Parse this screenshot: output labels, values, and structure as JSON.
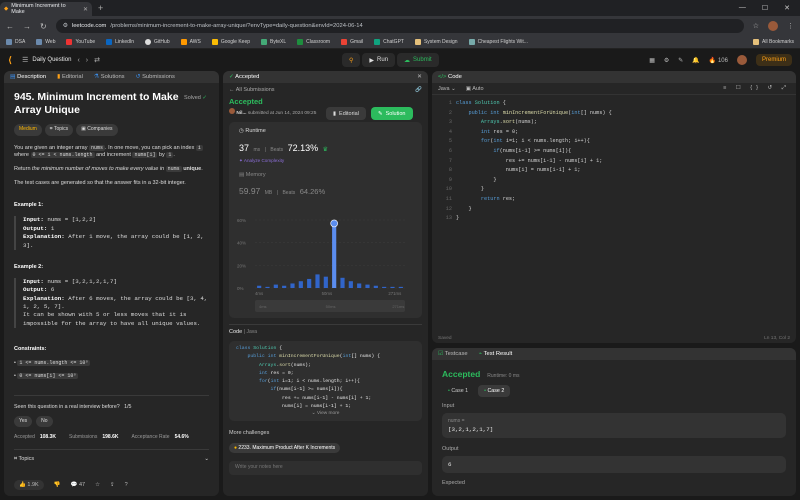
{
  "browser": {
    "tab_title": "Minimum Increment to Make",
    "url_host": "leetcode.com",
    "url_path": "/problems/minimum-increment-to-make-array-unique/?envType=daily-question&envId=2024-06-14",
    "bookmarks": [
      "DSA",
      "Web",
      "YouTube",
      "LinkedIn",
      "GitHub",
      "AWS",
      "Google Keep",
      "ByteXL",
      "Classroom",
      "Gmail",
      "ChatGPT",
      "System Design",
      "Cheapest Flights Wit..."
    ],
    "all_bookmarks": "All Bookmarks"
  },
  "nav": {
    "daily": "Daily Question",
    "run": "Run",
    "submit": "Submit",
    "streak": "106",
    "premium": "Premium"
  },
  "desc": {
    "tabs": [
      "Description",
      "Editorial",
      "Solutions",
      "Submissions"
    ],
    "title": "945. Minimum Increment to Make Array Unique",
    "solved": "Solved",
    "difficulty": "Medium",
    "topics": "Topics",
    "companies": "Companies",
    "p1a": "You are given an integer array",
    "p1b": "nums",
    "p1c": ". In one move, you can pick an index",
    "p1d": "i",
    "p1e": "where",
    "p1f": "0 <= i < nums.length",
    "p1g": "and increment",
    "p1h": "nums[i]",
    "p1i": "by",
    "p1j": "1",
    "p2a": "Return",
    "p2b": "the minimum number of moves to make every value in",
    "p2c": "nums",
    "p2d": "unique",
    "p3": "The test cases are generated so that the answer fits in a 32-bit integer.",
    "ex1": {
      "h": "Example 1:",
      "input": "nums = [1,2,2]",
      "output": "1",
      "expl": "After 1 move, the array could be [1, 2, 3]."
    },
    "ex2": {
      "h": "Example 2:",
      "input": "nums = [3,2,1,2,1,7]",
      "output": "6",
      "expl": "After 6 moves, the array could be [3, 4, 1, 2, 5, 7].",
      "expl2": "It can be shown with 5 or less moves that it is impossible for the array to have all unique values."
    },
    "cons_h": "Constraints:",
    "cons": [
      "1 <= nums.length <= 10⁵",
      "0 <= nums[i] <= 10⁵"
    ],
    "interview": "Seen this question in a real interview before?",
    "interview_pg": "1/5",
    "yes": "Yes",
    "no": "No",
    "stats": [
      "Accepted",
      "108.3K",
      "Submissions",
      "198.6K",
      "Acceptance Rate",
      "54.6%"
    ],
    "topics_footer": "Topics",
    "likes": "1.9K",
    "comments": "47"
  },
  "accepted": {
    "tab": "Accepted",
    "all": "All Submissions",
    "status": "Accepted",
    "user": "Nil...",
    "submitted": "submitted at Jun 14, 2024 09:25",
    "editorial": "Editorial",
    "solution": "Solution",
    "runtime_h": "Runtime",
    "runtime": "37",
    "ms": "ms",
    "beats": "Beats",
    "beats_pct": "72.13%",
    "analyze": "Analyze Complexity",
    "memory_h": "Memory",
    "memory": "59.97",
    "mb": "MB",
    "mem_beats": "64.26%",
    "yticks": [
      "60%",
      "40%",
      "20%",
      "0%"
    ],
    "xticks": [
      "4ms",
      "50ms",
      "271ms"
    ],
    "code_h": "Code",
    "lang": "Java",
    "code": [
      "class Solution {",
      "    public int minIncrementForUnique(int[] nums) {",
      "        Arrays.sort(nums);",
      "        int res = 0;",
      "        for(int i=1; i < nums.length; i++){",
      "            if(nums[i-1] >= nums[i]){",
      "                res += nums[i-1] - nums[i] + 1;",
      "                nums[i] = nums[i-1] + 1;"
    ],
    "view_more": "View more",
    "more_h": "More challenges",
    "more_item": "2233. Maximum Product After K Increments",
    "notes_ph": "Write your notes here"
  },
  "chart_data": {
    "type": "bar",
    "title": "",
    "xlabel": "",
    "ylabel": "",
    "ylim": [
      0,
      60
    ],
    "categories": [
      "4",
      "8",
      "12",
      "16",
      "20",
      "24",
      "28",
      "32",
      "36",
      "40",
      "44",
      "48",
      "52",
      "56",
      "60",
      "64",
      "68",
      "72"
    ],
    "values": [
      2,
      1,
      3,
      2,
      4,
      6,
      8,
      12,
      10,
      57,
      9,
      6,
      4,
      3,
      2,
      1,
      1,
      1
    ]
  },
  "editor": {
    "tab": "Code",
    "lang": "Java",
    "auto": "Auto",
    "lines": [
      "class Solution {",
      "    public int minIncrementForUnique(int[] nums) {",
      "        Arrays.sort(nums);",
      "        int res = 0;",
      "        for(int i=1; i < nums.length; i++){",
      "            if(nums[i-1] >= nums[i]){",
      "                res += nums[i-1] - nums[i] + 1;",
      "                nums[i] = nums[i-1] + 1;",
      "            }",
      "        }",
      "        return res;",
      "    }",
      "}"
    ],
    "saved": "Saved",
    "pos": "Ln 13, Col 2"
  },
  "test": {
    "tabs": [
      "Testcase",
      "Test Result"
    ],
    "status": "Accepted",
    "runtime": "Runtime: 0 ms",
    "cases": [
      "Case 1",
      "Case 2"
    ],
    "input_h": "Input",
    "var": "nums =",
    "input": "[3,2,1,2,1,7]",
    "output_h": "Output",
    "output": "6",
    "expected_h": "Expected"
  }
}
